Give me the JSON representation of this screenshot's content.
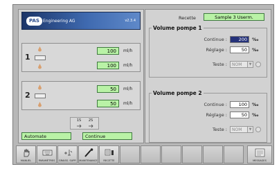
{
  "header": {
    "logo": "PAS",
    "company": "Engineering AG",
    "version": "v2.3.4"
  },
  "pumps": [
    {
      "number": "1",
      "value_top": "100",
      "unit_top": "ml/h",
      "value_bottom": "100",
      "unit_bottom": "ml/h"
    },
    {
      "number": "2",
      "value_top": "50",
      "unit_top": "ml/h",
      "value_bottom": "50",
      "unit_bottom": "ml/h"
    }
  ],
  "steps": {
    "step1": "1S",
    "step2": "2S"
  },
  "status": {
    "mode": "Automate",
    "state": "Continue"
  },
  "recette": {
    "label": "Recette",
    "value": "Sample 3 Userm."
  },
  "volume_pumps": [
    {
      "title": "Volume pompe 1",
      "continue_label": "Continue :",
      "continue_value": "200",
      "reglage_label": "Réglage :",
      "reglage_value": "50",
      "unit": "‰",
      "teste_label": "Teste :",
      "teste_value": "NOM"
    },
    {
      "title": "Volume pompe 2",
      "continue_label": "Continue :",
      "continue_value": "100",
      "reglage_label": "Réglage :",
      "reglage_value": "50",
      "unit": "‰",
      "teste_label": "Teste :",
      "teste_value": "NOM"
    }
  ],
  "toolbar": [
    {
      "label": "MANUEL",
      "icon": "hand-icon"
    },
    {
      "label": "PARAMÈTRES",
      "icon": "keyboard-icon"
    },
    {
      "label": "GRAISS. SUPP.",
      "icon": "grease-icon"
    },
    {
      "label": "MAINTENANCE",
      "icon": "wrench-icon"
    },
    {
      "label": "RECETTE",
      "icon": "recipe-icon"
    },
    {
      "label": "MESSAGES",
      "icon": "messages-icon"
    }
  ],
  "colors": {
    "status_green": "#b9f2a6",
    "banner_blue": "#2a4b8c",
    "selected_input": "#25327a"
  }
}
